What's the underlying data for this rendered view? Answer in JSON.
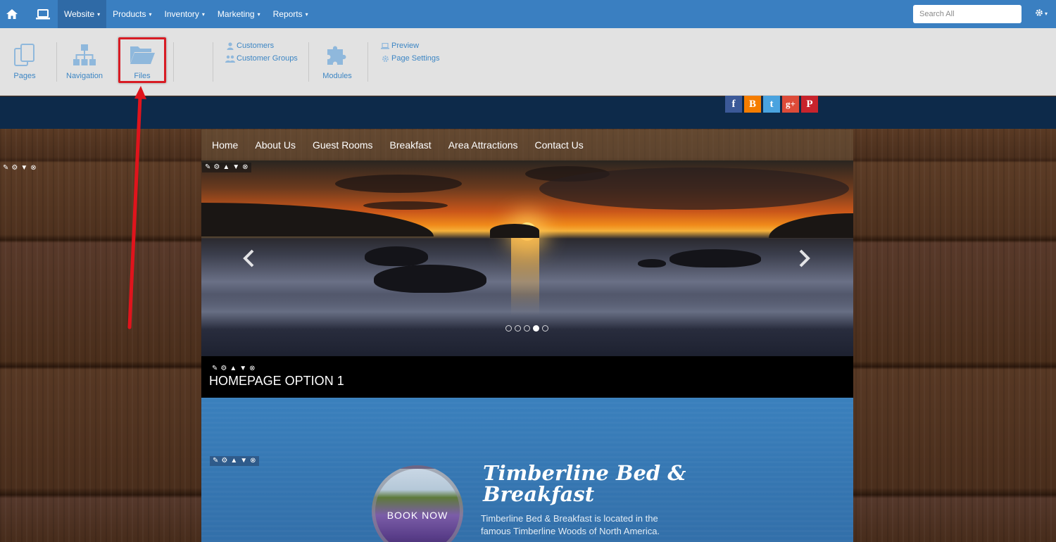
{
  "topbar": {
    "menu": [
      {
        "label": "Website",
        "active": true
      },
      {
        "label": "Products",
        "active": false
      },
      {
        "label": "Inventory",
        "active": false
      },
      {
        "label": "Marketing",
        "active": false
      },
      {
        "label": "Reports",
        "active": false
      }
    ],
    "search_placeholder": "Search All",
    "caret": "▾"
  },
  "ribbon": {
    "pages": "Pages",
    "navigation": "Navigation",
    "files": "Files",
    "customers": "Customers",
    "customer_groups": "Customer Groups",
    "modules": "Modules",
    "preview": "Preview",
    "page_settings": "Page Settings"
  },
  "site": {
    "nav": [
      "Home",
      "About Us",
      "Guest Rooms",
      "Breakfast",
      "Area Attractions",
      "Contact Us"
    ],
    "caption": "HOMEPAGE OPTION 1",
    "book_now": "BOOK NOW",
    "title": "Timberline Bed & Breakfast",
    "description": "Timberline Bed & Breakfast is located in the famous Timberline Woods of North America.",
    "slider_active_dot": 4,
    "slider_dot_count": 5
  },
  "social": [
    {
      "name": "facebook",
      "glyph": "f",
      "color": "#3b5998"
    },
    {
      "name": "blogger",
      "glyph": "B",
      "color": "#f57d00"
    },
    {
      "name": "twitter",
      "glyph": "t",
      "color": "#4aa3df"
    },
    {
      "name": "google-plus",
      "glyph": "g+",
      "color": "#dd4b39"
    },
    {
      "name": "pinterest",
      "glyph": "P",
      "color": "#c8232c"
    }
  ],
  "colors": {
    "topbar": "#3a7fc1",
    "ribbon_text": "#3d86c4",
    "highlight": "#d81c24"
  }
}
